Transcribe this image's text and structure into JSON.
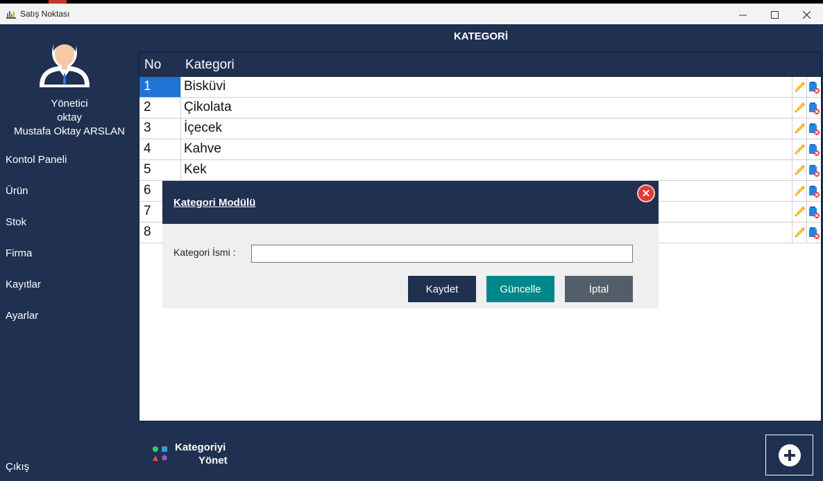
{
  "window": {
    "title": "Satış Noktası",
    "controls": {
      "minimize": "—",
      "maximize": "☐",
      "close": "✕"
    }
  },
  "user": {
    "role": "Yönetici",
    "username": "oktay",
    "full_name": "Mustafa Oktay ARSLAN"
  },
  "sidebar": {
    "items": [
      {
        "label": "Kontol Paneli"
      },
      {
        "label": "Ürün"
      },
      {
        "label": "Stok"
      },
      {
        "label": "Firma"
      },
      {
        "label": "Kayıtlar"
      },
      {
        "label": "Ayarlar"
      }
    ],
    "logout": "Çıkış"
  },
  "page": {
    "title": "KATEGORİ"
  },
  "table": {
    "headers": {
      "no": "No",
      "category": "Kategori"
    },
    "rows": [
      {
        "no": "1",
        "category": "Bisküvi"
      },
      {
        "no": "2",
        "category": "Çikolata"
      },
      {
        "no": "3",
        "category": "İçecek"
      },
      {
        "no": "4",
        "category": "Kahve"
      },
      {
        "no": "5",
        "category": "Kek"
      },
      {
        "no": "6",
        "category": ""
      },
      {
        "no": "7",
        "category": ""
      },
      {
        "no": "8",
        "category": ""
      }
    ],
    "selected_row": 1
  },
  "modal": {
    "title": "Kategori Modülü",
    "close_icon": "close-icon",
    "field_label": "Kategori İsmi :",
    "field_value": "",
    "buttons": {
      "save": "Kaydet",
      "update": "Güncelle",
      "cancel": "İptal"
    }
  },
  "footer": {
    "manage_line1": "Kategoriyi",
    "manage_line2": "Yönet",
    "add_icon": "plus-circle-icon"
  },
  "colors": {
    "navy": "#1f3050",
    "selected_blue": "#1e73d6",
    "teal": "#00878a",
    "cancel_gray": "#535e6b",
    "close_red": "#e53935"
  }
}
